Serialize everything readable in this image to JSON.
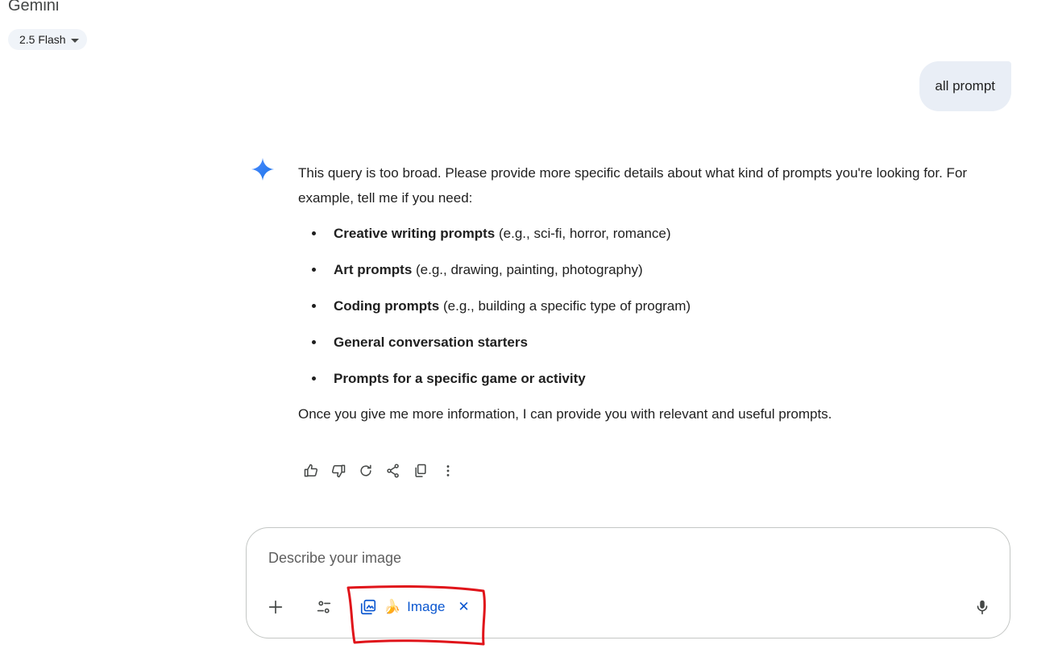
{
  "header": {
    "app_title": "Gemini",
    "model_label": "2.5 Flash"
  },
  "conversation": {
    "user_message": "all prompt",
    "response": {
      "intro": "This query is too broad. Please provide more specific details about what kind of prompts you're looking for. For example, tell me if you need:",
      "items": [
        {
          "bold": "Creative writing prompts",
          "rest": " (e.g., sci-fi, horror, romance)"
        },
        {
          "bold": "Art prompts",
          "rest": " (e.g., drawing, painting, photography)"
        },
        {
          "bold": "Coding prompts",
          "rest": " (e.g., building a specific type of program)"
        },
        {
          "bold": "General conversation starters",
          "rest": ""
        },
        {
          "bold": "Prompts for a specific game or activity",
          "rest": ""
        }
      ],
      "closing": "Once you give me more information, I can provide you with relevant and useful prompts."
    },
    "actions": [
      "thumb-up-icon",
      "thumb-down-icon",
      "regenerate-icon",
      "share-icon",
      "copy-icon",
      "more-vert-icon"
    ]
  },
  "composer": {
    "placeholder": "Describe your image",
    "chip_label": "Image",
    "chip_emoji": "🍌",
    "chip_close": "✕"
  },
  "colors": {
    "accent": "#0b57d0",
    "user_bubble": "#e9eef6",
    "annotation": "#e0141a"
  }
}
